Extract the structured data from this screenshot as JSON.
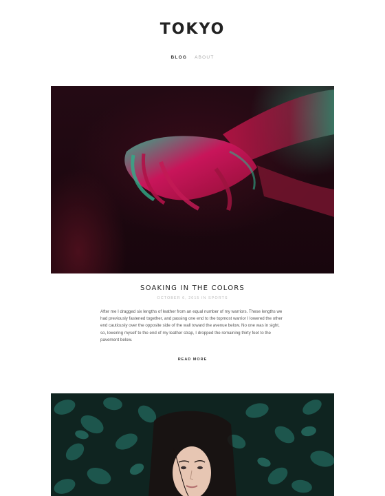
{
  "site": {
    "title": "TOKYO"
  },
  "nav": {
    "items": [
      {
        "label": "BLOG"
      },
      {
        "label": "ABOUT"
      }
    ]
  },
  "post": {
    "title": "SOAKING IN THE COLORS",
    "meta": "OCTOBER 6, 2015 IN SPORTS",
    "excerpt": "After me I dragged six lengths of leather from an equal number of my warriors. These lengths we had previously fastened together, and passing one end to the topmost warrior I lowered the other end cautiously over the opposite side of the wall toward the avenue below. No one was in sight, so, lowering myself to the end of my leather strap, I dropped the remaining thirty feet to the pavement below.",
    "read_more": "READ MORE"
  },
  "colors": {
    "accent": "#222222",
    "muted": "#aaaaaa",
    "hero_dark": "#1a0810",
    "leaves": "#1f5c52"
  }
}
